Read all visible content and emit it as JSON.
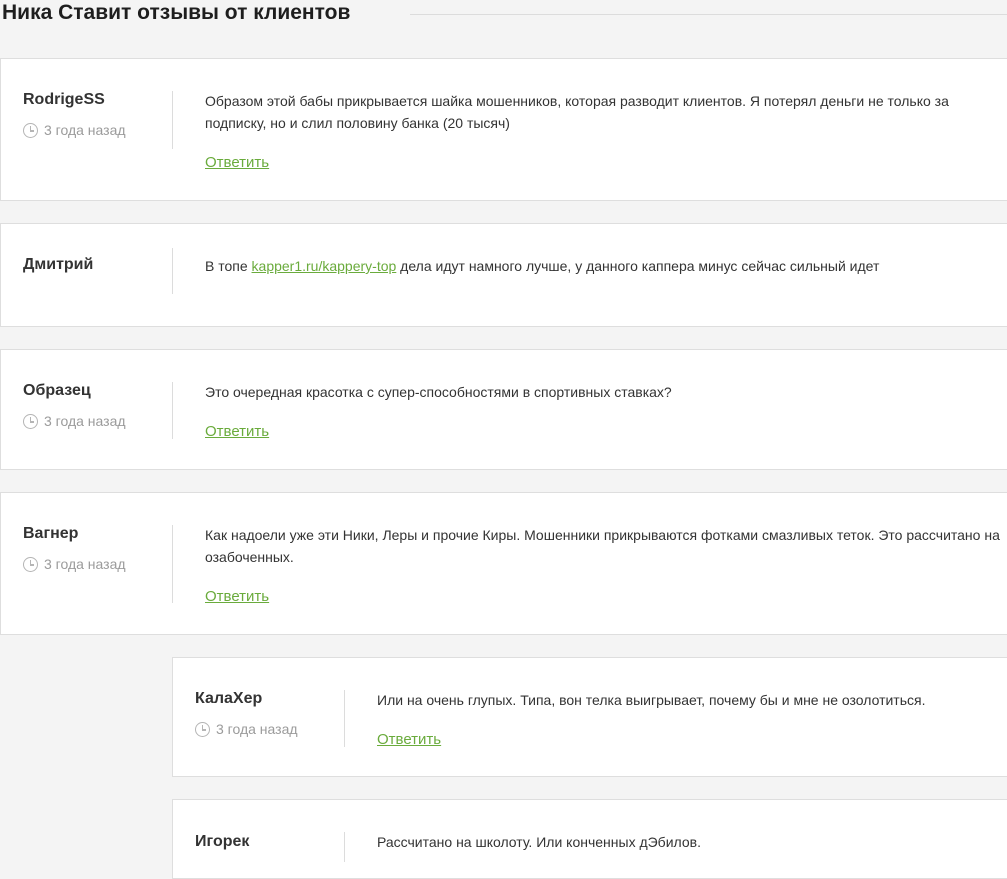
{
  "section": {
    "title": "Ника Ставит отзывы от клиентов"
  },
  "comments": [
    {
      "author": "RodrigeSS",
      "time": "3 года назад",
      "text": "Образом этой бабы прикрывается шайка мошенников, которая разводит клиентов. Я потерял деньги не только за подписку, но и слил половину банка (20 тысяч)",
      "reply": "Ответить"
    },
    {
      "author": "Дмитрий",
      "text_before": "В топе ",
      "link": "kapper1.ru/kappery-top",
      "text_after": " дела идут намного лучше, у данного каппера минус сейчас сильный идет"
    },
    {
      "author": "Образец",
      "time": "3 года назад",
      "text": "Это очередная красотка с супер-способностями в спортивных ставках?",
      "reply": "Ответить"
    },
    {
      "author": "Вагнер",
      "time": "3 года назад",
      "text": "Как надоели уже эти Ники, Леры и прочие Киры. Мошенники прикрываются фотками смазливых теток. Это рассчитано на озабоченных.",
      "reply": "Ответить"
    },
    {
      "author": "КалаХер",
      "time": "3 года назад",
      "text": "Или на очень глупых. Типа, вон телка выигрывает, почему бы и мне не озолотиться.",
      "reply": "Ответить"
    },
    {
      "author": "Игорек",
      "text": "Рассчитано на школоту. Или конченных дЭбилов."
    }
  ],
  "colors": {
    "link": "#6aab3c",
    "background": "#f4f4f4",
    "card": "#ffffff",
    "muted": "#9b9b9b"
  },
  "icons": {
    "time": "clock-icon"
  }
}
